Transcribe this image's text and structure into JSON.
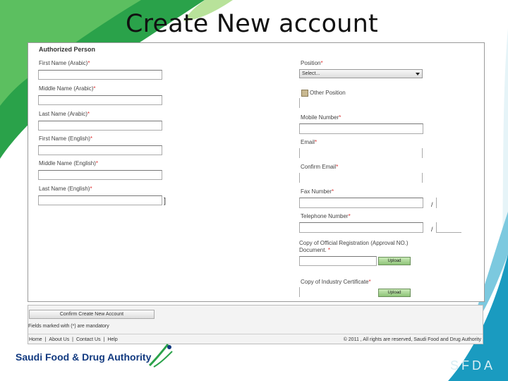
{
  "slide_title": "Create New account",
  "section_title": "Authorized Person",
  "left_fields": [
    {
      "label": "First Name (Arabic)",
      "req": "*"
    },
    {
      "label": "Middle Name (Arabic)",
      "req": "*"
    },
    {
      "label": "Last Name (Arabic)",
      "req": "*"
    },
    {
      "label": "First Name (English)",
      "req": "*"
    },
    {
      "label": "Middle Name (English)",
      "req": "*"
    },
    {
      "label": "Last Name (English)",
      "req": "*"
    }
  ],
  "position": {
    "label": "Position",
    "req": "*",
    "selected": "Select..."
  },
  "other_position": {
    "label": "Other Position"
  },
  "mobile": {
    "label": "Mobile Number",
    "req": "*"
  },
  "email": {
    "label": "Email",
    "req": "*"
  },
  "confirm_email": {
    "label": "Confirm Email",
    "req": "*"
  },
  "fax": {
    "label": "Fax Number",
    "req": "*",
    "sep": "/"
  },
  "telephone": {
    "label": "Telephone Number",
    "req": "*",
    "sep": "/"
  },
  "registration_doc": {
    "label_line1": "Copy of Official Registration (Approval NO.)",
    "label_line2": "Document.",
    "req": "*",
    "upload": "Upload"
  },
  "industry_cert": {
    "label": "Copy of Industry Certificate",
    "req": "*",
    "upload": "Upload"
  },
  "footer": {
    "confirm_button": "Confirm Create New Account",
    "mandatory_note": "Fields marked with (*) are mandatory",
    "links": [
      "Home",
      "About Us",
      "Contact Us",
      "Help"
    ],
    "link_separator": "|",
    "copyright": "© 2011 , All rights are reserved, Saudi Food and Drug Authority"
  },
  "brand": {
    "name": "Saudi Food & Drug Authority",
    "abbr": "SFDA"
  },
  "colors": {
    "green": "#2aa24a",
    "teal": "#1a9bc0",
    "navy": "#123a80"
  }
}
